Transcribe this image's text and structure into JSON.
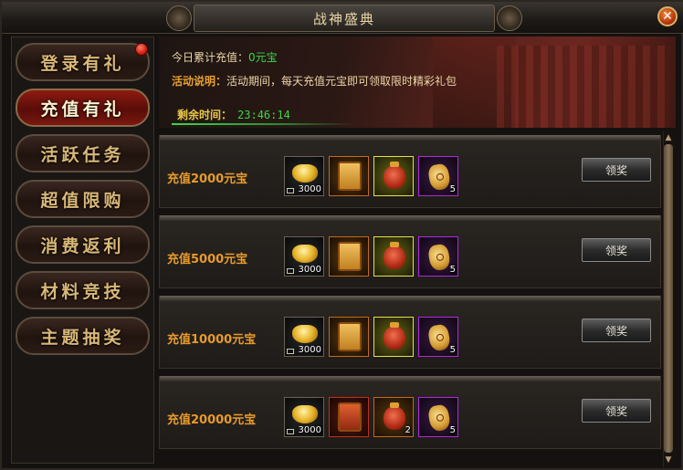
{
  "window": {
    "title": "战神盛典",
    "close_label": "✕"
  },
  "sidebar": {
    "items": [
      {
        "label": "登录有礼",
        "active": false,
        "has_dot": true
      },
      {
        "label": "充值有礼",
        "active": true,
        "has_dot": false
      },
      {
        "label": "活跃任务",
        "active": false,
        "has_dot": false
      },
      {
        "label": "超值限购",
        "active": false,
        "has_dot": false
      },
      {
        "label": "消费返利",
        "active": false,
        "has_dot": false
      },
      {
        "label": "材料竞技",
        "active": false,
        "has_dot": false
      },
      {
        "label": "主题抽奖",
        "active": false,
        "has_dot": false
      }
    ]
  },
  "info": {
    "today_label": "今日累计充值：",
    "today_value": "0元宝",
    "desc_label": "活动说明：",
    "desc_text": "活动期间，每天充值元宝即可领取限时精彩礼包",
    "timer_label": "剩余时间：",
    "timer_value": "23:46:14"
  },
  "rewards": [
    {
      "title": "充值2000元宝",
      "button": "领奖",
      "items": [
        {
          "icon": "gold-ingot-icon",
          "count": "3000"
        },
        {
          "icon": "scroll-icon",
          "count": ""
        },
        {
          "icon": "red-gift-bag-icon",
          "count": ""
        },
        {
          "icon": "gold-pouch-icon",
          "count": "5"
        }
      ]
    },
    {
      "title": "充值5000元宝",
      "button": "领奖",
      "items": [
        {
          "icon": "gold-ingot-icon",
          "count": "3000"
        },
        {
          "icon": "scroll-icon",
          "count": ""
        },
        {
          "icon": "red-gift-bag-icon",
          "count": ""
        },
        {
          "icon": "gold-pouch-icon",
          "count": "5"
        }
      ]
    },
    {
      "title": "充值10000元宝",
      "button": "领奖",
      "items": [
        {
          "icon": "gold-ingot-icon",
          "count": "3000"
        },
        {
          "icon": "scroll-icon",
          "count": ""
        },
        {
          "icon": "red-gift-bag-icon",
          "count": ""
        },
        {
          "icon": "gold-pouch-icon",
          "count": "5"
        }
      ]
    },
    {
      "title": "充值20000元宝",
      "button": "领奖",
      "items": [
        {
          "icon": "gold-ingot-icon",
          "count": "3000"
        },
        {
          "icon": "scroll-icon",
          "count": ""
        },
        {
          "icon": "red-gift-bag-icon",
          "count": "2"
        },
        {
          "icon": "gold-pouch-icon",
          "count": "5"
        }
      ]
    }
  ],
  "colors": {
    "accent_orange": "#e89a2a",
    "timer_green": "#3bd64a",
    "active_tab": "#8e1b12"
  }
}
